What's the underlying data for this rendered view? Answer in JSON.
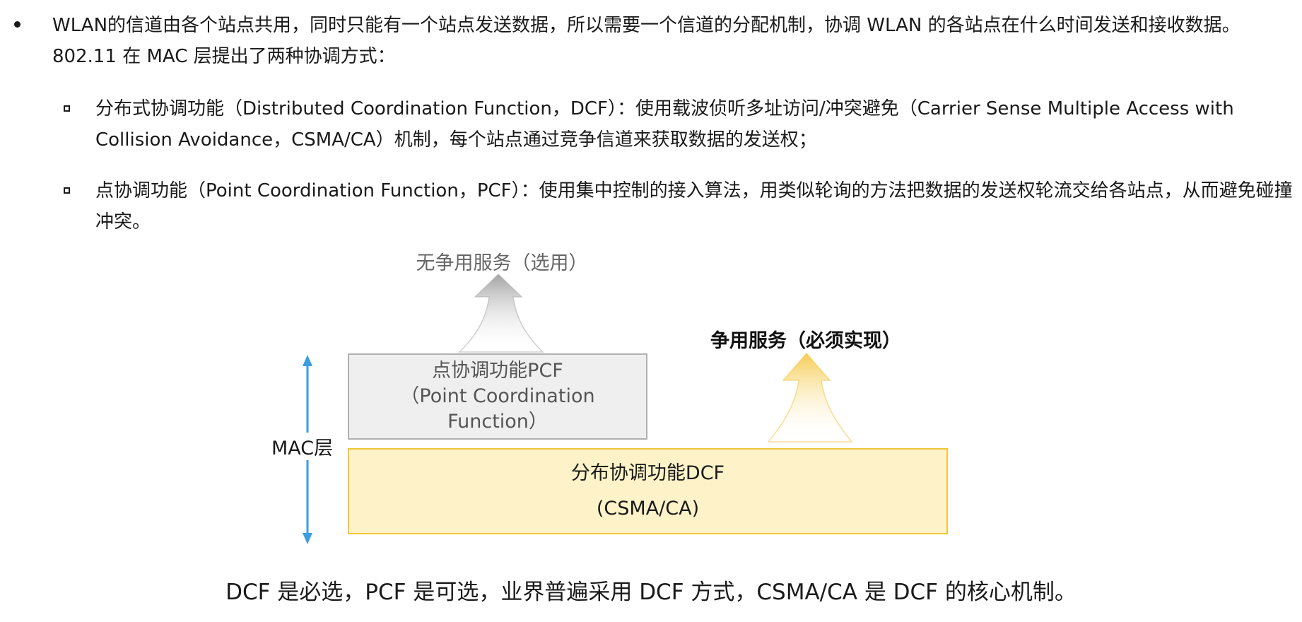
{
  "bullets": {
    "main": "WLAN的信道由各个站点共用，同时只能有一个站点发送数据，所以需要一个信道的分配机制，协调 WLAN 的各站点在什么时间发送和接收数据。802.11 在 MAC 层提出了两种协调方式：",
    "sub": [
      "分布式协调功能（Distributed Coordination Function，DCF）：使用载波侦听多址访问/冲突避免（Carrier Sense Multiple Access with Collision Avoidance，CSMA/CA）机制，每个站点通过竞争信道来获取数据的发送权；",
      "点协调功能（Point Coordination Function，PCF）：使用集中控制的接入算法，用类似轮询的方法把数据的发送权轮流交给各站点，从而避免碰撞冲突。"
    ]
  },
  "diagram": {
    "contention_free_label": "无争用服务（选用）",
    "contention_label": "争用服务（必须实现）",
    "pcf_box": {
      "line1": "点协调功能PCF",
      "line2": "（Point Coordination",
      "line3": "Function）"
    },
    "dcf_box": {
      "line1": "分布协调功能DCF",
      "line2": "(CSMA/CA)"
    },
    "mac_label": "MAC层",
    "colors": {
      "pcf_fill": "#efefef",
      "pcf_border": "#b0b0b0",
      "dcf_fill": "#fdf2c8",
      "dcf_border": "#f2c83a",
      "mac_arrow": "#3b9ee0",
      "gray_arrow": "#a8a8a8",
      "yellow_arrow": "#f5c94a"
    }
  },
  "conclusion": "DCF 是必选，PCF 是可选，业界普遍采用 DCF 方式，CSMA/CA 是 DCF 的核心机制。"
}
